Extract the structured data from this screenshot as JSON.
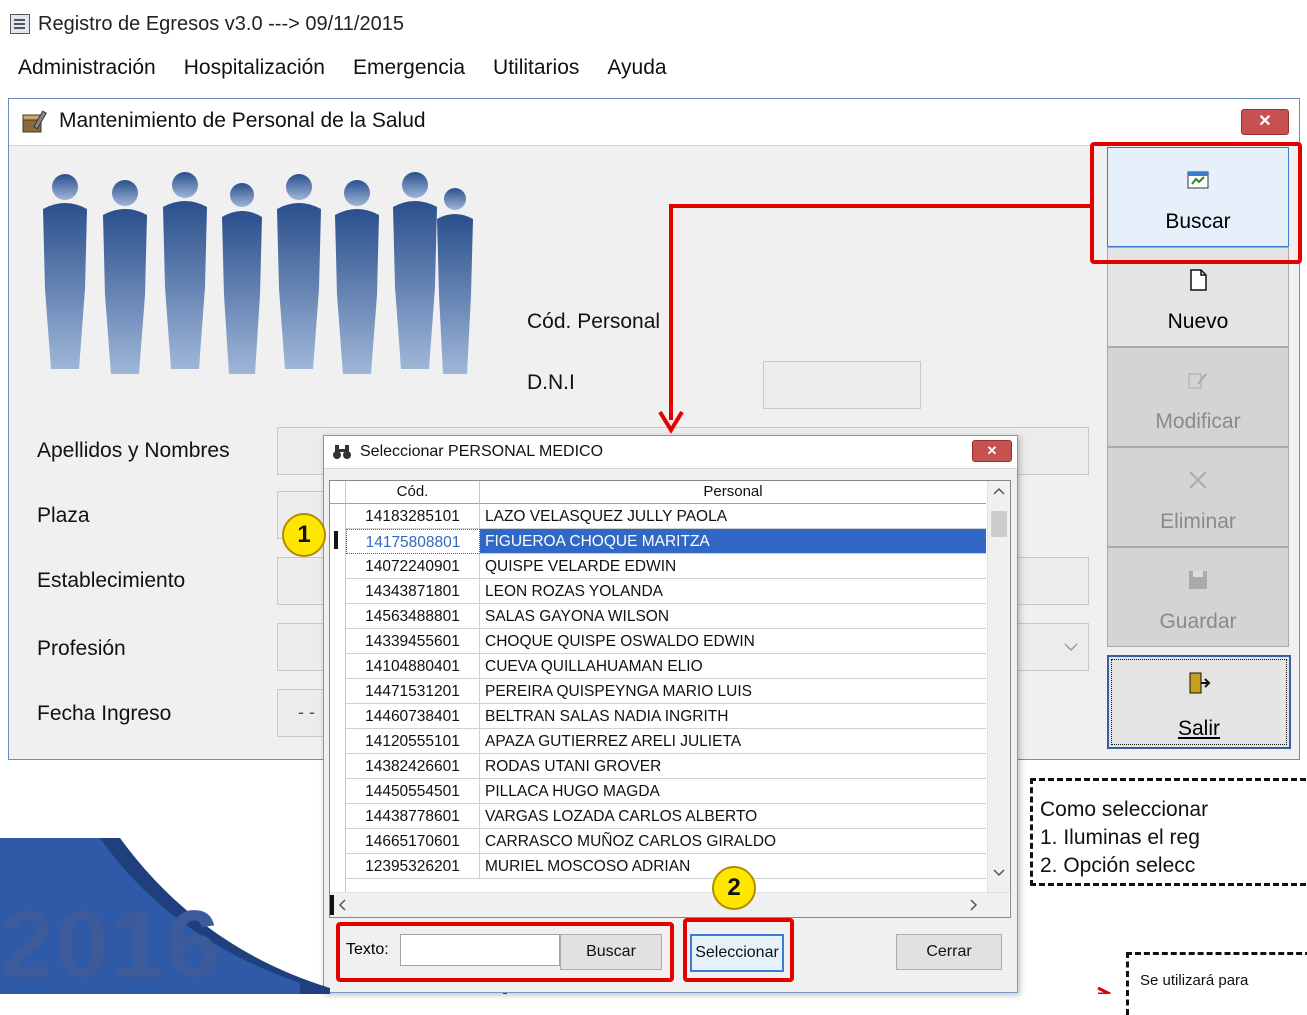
{
  "app": {
    "title": "Registro de Egresos v3.0  ---> 09/11/2015"
  },
  "menu": [
    "Administración",
    "Hospitalización",
    "Emergencia",
    "Utilitarios",
    "Ayuda"
  ],
  "main_window": {
    "title": "Mantenimiento de Personal de la Salud",
    "close_label": "✕",
    "labels": {
      "cod_personal": "Cód. Personal",
      "dni": "D.N.I",
      "apellidos": "Apellidos y Nombres",
      "plaza": "Plaza",
      "establecimiento": "Establecimiento",
      "profesion": "Profesión",
      "fecha_ingreso": "Fecha Ingreso"
    },
    "fecha_value": "- -",
    "toolbar": {
      "buscar": "Buscar",
      "nuevo": "Nuevo",
      "modificar": "Modificar",
      "eliminar": "Eliminar",
      "guardar": "Guardar",
      "salir": "Salir"
    }
  },
  "dialog": {
    "title": "Seleccionar PERSONAL MEDICO",
    "close_label": "✕",
    "columns": [
      "Cód.",
      "Personal"
    ],
    "rows": [
      {
        "cod": "14183285101",
        "nombre": "LAZO VELASQUEZ JULLY PAOLA"
      },
      {
        "cod": "14175808801",
        "nombre": "FIGUEROA CHOQUE MARITZA"
      },
      {
        "cod": "14072240901",
        "nombre": "QUISPE VELARDE EDWIN"
      },
      {
        "cod": "14343871801",
        "nombre": "LEON ROZAS YOLANDA"
      },
      {
        "cod": "14563488801",
        "nombre": "SALAS GAYONA WILSON"
      },
      {
        "cod": "14339455601",
        "nombre": "CHOQUE QUISPE OSWALDO EDWIN"
      },
      {
        "cod": "14104880401",
        "nombre": "CUEVA QUILLAHUAMAN ELIO"
      },
      {
        "cod": "14471531201",
        "nombre": "PEREIRA QUISPEYNGA MARIO LUIS"
      },
      {
        "cod": "14460738401",
        "nombre": "BELTRAN SALAS NADIA INGRITH"
      },
      {
        "cod": "14120555101",
        "nombre": "APAZA GUTIERREZ ARELI JULIETA"
      },
      {
        "cod": "14382426601",
        "nombre": "RODAS UTANI GROVER"
      },
      {
        "cod": "14450554501",
        "nombre": "PILLACA HUGO MAGDA"
      },
      {
        "cod": "14438778601",
        "nombre": "VARGAS LOZADA CARLOS ALBERTO"
      },
      {
        "cod": "14665170601",
        "nombre": "CARRASCO MUÑOZ CARLOS GIRALDO"
      },
      {
        "cod": "12395326201",
        "nombre": "MURIEL MOSCOSO ADRIAN"
      }
    ],
    "selected_row": 1,
    "texto_label": "Texto:",
    "texto_value": "",
    "buscar": "Buscar",
    "seleccionar": "Seleccionar",
    "cerrar": "Cerrar"
  },
  "annotations": {
    "badge1": "1",
    "badge2": "2",
    "note_line1": "Como seleccionar",
    "note_line2": "1. Iluminas el reg",
    "note_line3": "2. Opción selecc",
    "note2": "Se utilizará para",
    "year": "2016"
  },
  "colors": {
    "highlight": "#e30000",
    "selection": "#3168c6",
    "badge": "#ffe600"
  }
}
